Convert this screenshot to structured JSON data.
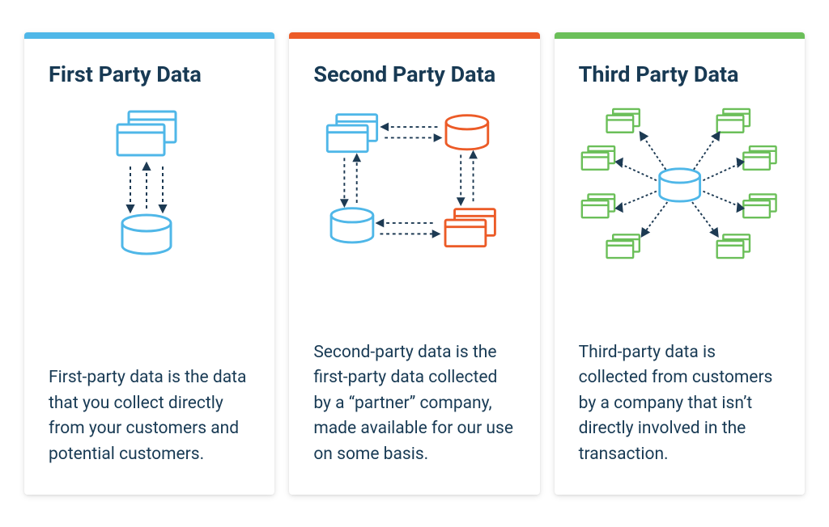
{
  "colors": {
    "blue": "#4fb7e8",
    "orange": "#ec5b27",
    "green": "#6bbf59",
    "text": "#183a54",
    "arrow": "#1d3a53"
  },
  "cards": [
    {
      "id": "first-party",
      "accent": "#4fb7e8",
      "title": "First Party Data",
      "description": "First-party data is the data that you collect directly from your customers and potential customers."
    },
    {
      "id": "second-party",
      "accent": "#ec5b27",
      "title": "Second Party Data",
      "description": "Second-party data is the first-party data collected by a “partner” company, made available for our use on some basis."
    },
    {
      "id": "third-party",
      "accent": "#6bbf59",
      "title": "Third Party Data",
      "description": "Third-party data is collected from customers by a company that isn’t directly involved in the transaction."
    }
  ]
}
